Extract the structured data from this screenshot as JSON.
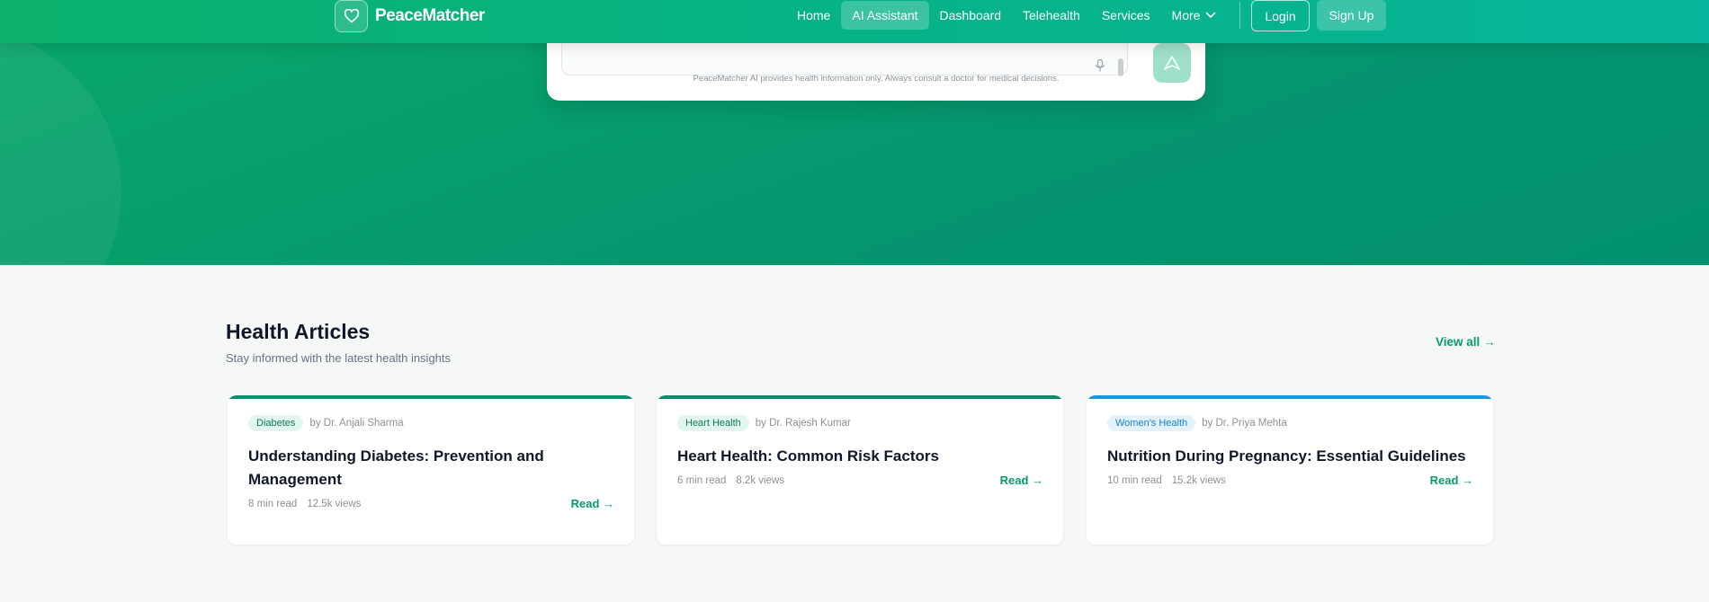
{
  "brand": {
    "name": "PeaceMatcher",
    "logo_icon": "heart-icon"
  },
  "nav": {
    "items": [
      {
        "label": "Home",
        "active": false
      },
      {
        "label": "AI Assistant",
        "active": true
      },
      {
        "label": "Dashboard",
        "active": false
      },
      {
        "label": "Telehealth",
        "active": false
      },
      {
        "label": "Services",
        "active": false
      },
      {
        "label": "More",
        "active": false,
        "icon": "chevron-down-icon"
      }
    ],
    "login_label": "Login",
    "signup_label": "Sign Up"
  },
  "chat": {
    "mic_icon": "microphone-icon",
    "send_icon": "send-icon",
    "disclaimer": "PeaceMatcher AI provides health information only. Always consult a doctor for medical decisions."
  },
  "articles": {
    "title": "Health Articles",
    "subtitle": "Stay informed with the latest health insights",
    "view_all_label": "View all →",
    "items": [
      {
        "tag": "Diabetes",
        "author": "by Dr. Anjali Sharma",
        "title": "Understanding Diabetes: Prevention and Management",
        "read_time": "8 min read",
        "views": "12.5k views",
        "read_label": "Read →",
        "accent_color": "#05916a",
        "tag_bg": "#e3f6ee",
        "tag_color": "#067a58"
      },
      {
        "tag": "Heart Health",
        "author": "by Dr. Rajesh Kumar",
        "title": "Heart Health: Common Risk Factors",
        "read_time": "6 min read",
        "views": "8.2k views",
        "read_label": "Read →",
        "accent_color": "#0f8a66",
        "tag_bg": "#e3f6ee",
        "tag_color": "#067a58"
      },
      {
        "tag": "Women's Health",
        "author": "by Dr. Priya Mehta",
        "title": "Nutrition During Pregnancy: Essential Guidelines",
        "read_time": "10 min read",
        "views": "15.2k views",
        "read_label": "Read →",
        "accent_color": "#1b95e0",
        "tag_bg": "#e3f2fc",
        "tag_color": "#1483cc"
      }
    ]
  },
  "colors": {
    "primary": "#0bb06b",
    "hero": "#03916f",
    "link": "#069c6c",
    "background": "#f6f8f7"
  }
}
